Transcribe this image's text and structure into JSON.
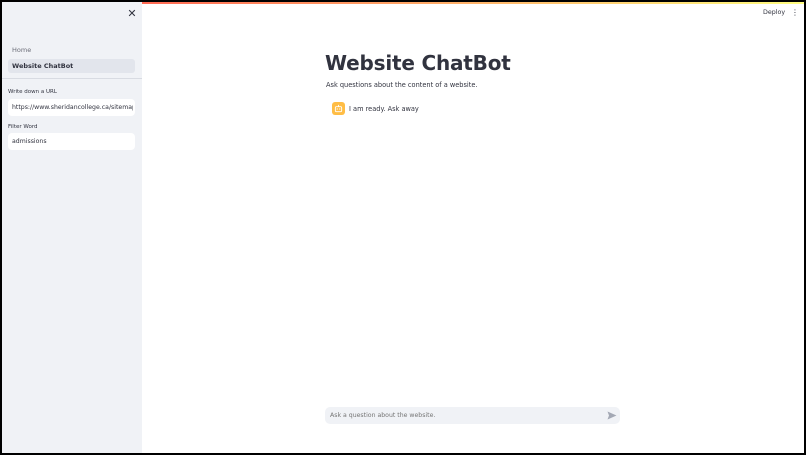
{
  "sidebar": {
    "close_icon": "close-icon",
    "nav": [
      {
        "label": "Home",
        "active": false
      },
      {
        "label": "Website ChatBot",
        "active": true
      }
    ],
    "url_field": {
      "label": "Write down a URL",
      "value": "https://www.sheridancollege.ca/sitemap.xml"
    },
    "filter_field": {
      "label": "Filter Word",
      "value": "admissions"
    }
  },
  "header": {
    "deploy_label": "Deploy",
    "menu_icon": "more-vertical-icon"
  },
  "main": {
    "title": "Website ChatBot",
    "subtitle": "Ask questions about the content of a website.",
    "messages": [
      {
        "role": "assistant",
        "avatar_icon": "bot-icon",
        "text": "I am ready. Ask away"
      }
    ]
  },
  "chat_input": {
    "placeholder": "Ask a question about the website.",
    "send_icon": "send-icon"
  },
  "colors": {
    "sidebar_bg": "#f0f2f6",
    "text": "#31333f",
    "avatar_bg": "#ffbd45",
    "accent": "#ff4b4b"
  }
}
